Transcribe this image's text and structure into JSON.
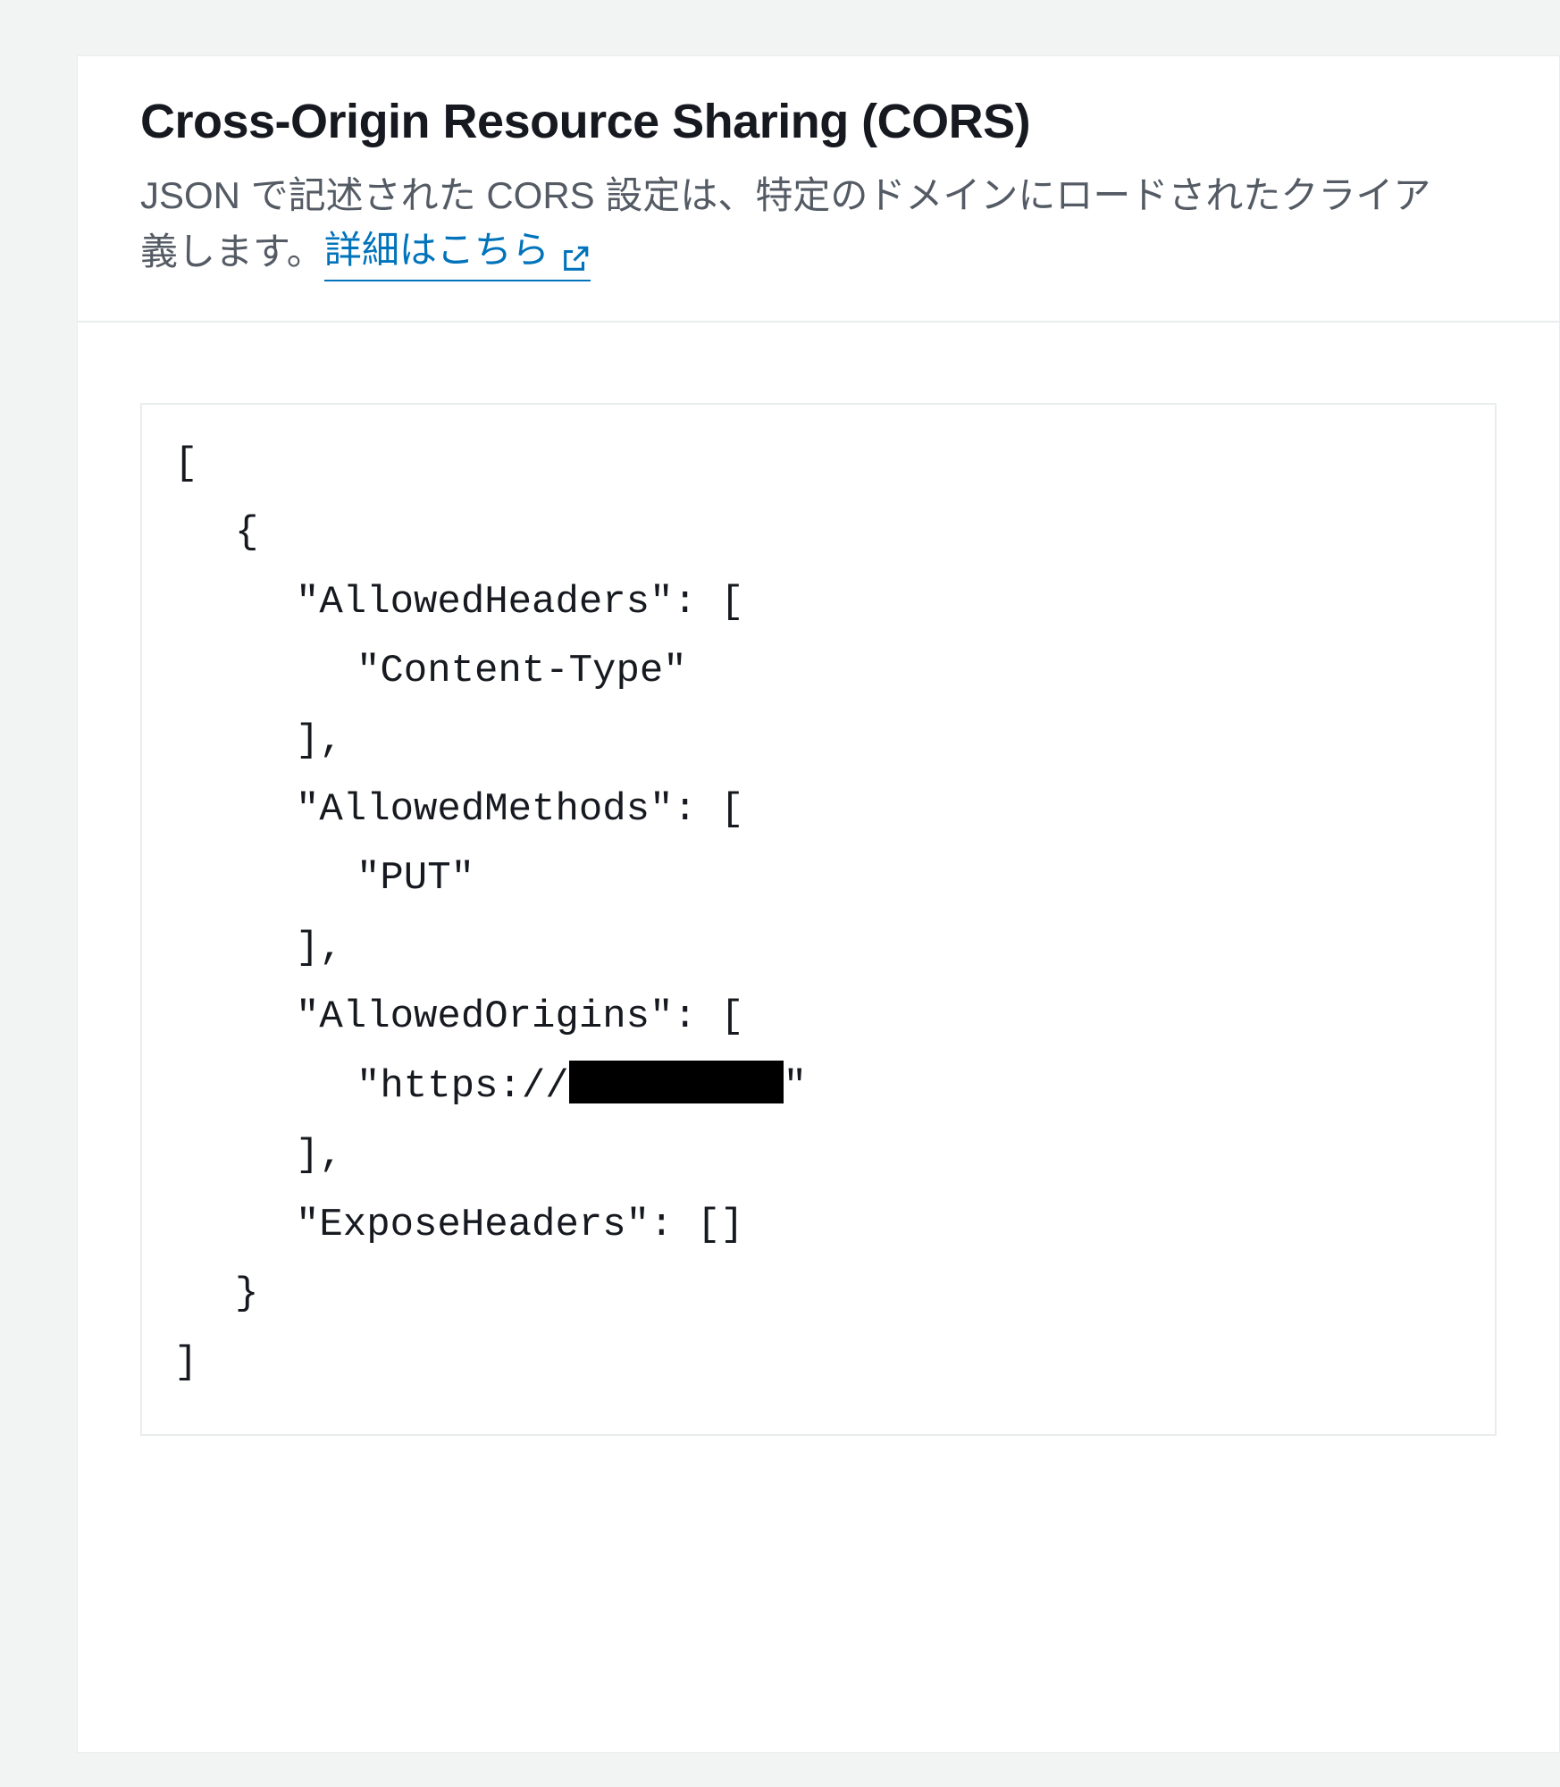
{
  "header": {
    "title": "Cross-Origin Resource Sharing (CORS)",
    "description_line1": "JSON で記述された CORS 設定は、特定のドメインにロードされたクライア",
    "description_prefix2": "義します。",
    "learn_more_text": "詳細はこちら"
  },
  "code": {
    "l0": "[",
    "l1": "{",
    "l2": "\"AllowedHeaders\": [",
    "l3": "\"Content-Type\"",
    "l4": "],",
    "l5": "\"AllowedMethods\": [",
    "l6": "\"PUT\"",
    "l7": "],",
    "l8": "\"AllowedOrigins\": [",
    "l9_pre": "\"https://",
    "l9_post": "\"",
    "l10": "],",
    "l11": "\"ExposeHeaders\": []",
    "l12": "}",
    "l13": "]"
  },
  "cors_config": [
    {
      "AllowedHeaders": [
        "Content-Type"
      ],
      "AllowedMethods": [
        "PUT"
      ],
      "AllowedOrigins": [
        "https://[redacted]"
      ],
      "ExposeHeaders": []
    }
  ]
}
